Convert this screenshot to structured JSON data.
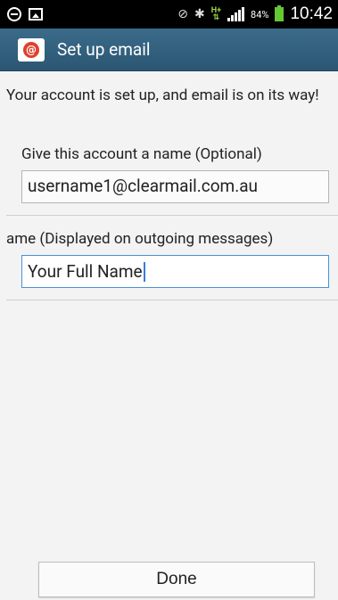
{
  "status_bar": {
    "battery_percent": "84%",
    "time": "10:42",
    "network": "H+"
  },
  "action_bar": {
    "title": "Set up email",
    "icon": "email-app-icon"
  },
  "main": {
    "message": "Your account is set up, and email is on its way!",
    "account_name_label": "Give this account a name (Optional)",
    "account_name_value": "username1@clearmail.com.au",
    "your_name_label": "ame (Displayed on outgoing messages)",
    "your_name_value": "Your Full Name"
  },
  "footer": {
    "done_label": "Done"
  },
  "colors": {
    "action_bar": "#2e5d7a",
    "focus_border": "#4a90d9",
    "battery": "#64c832"
  }
}
